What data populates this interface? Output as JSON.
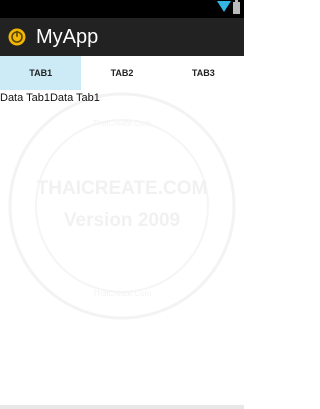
{
  "status_bar": {
    "icons": [
      "signal-icon",
      "battery-icon"
    ]
  },
  "action_bar": {
    "app_icon": "app-logo-icon",
    "title": "MyApp"
  },
  "tabs": [
    {
      "label": "TAB1",
      "selected": true
    },
    {
      "label": "TAB2",
      "selected": false
    },
    {
      "label": "TAB3",
      "selected": false
    }
  ],
  "content": {
    "text": "Data Tab1Data Tab1"
  },
  "watermark": {
    "brand": "THAICREATE.COM",
    "version": "Version 2009",
    "ring_text": "ThaiCreate.Com"
  },
  "colors": {
    "status_bar_bg": "#000000",
    "action_bar_bg": "#222222",
    "selected_tab_bg": "#ccebf6",
    "signal_color": "#33b5e5"
  }
}
